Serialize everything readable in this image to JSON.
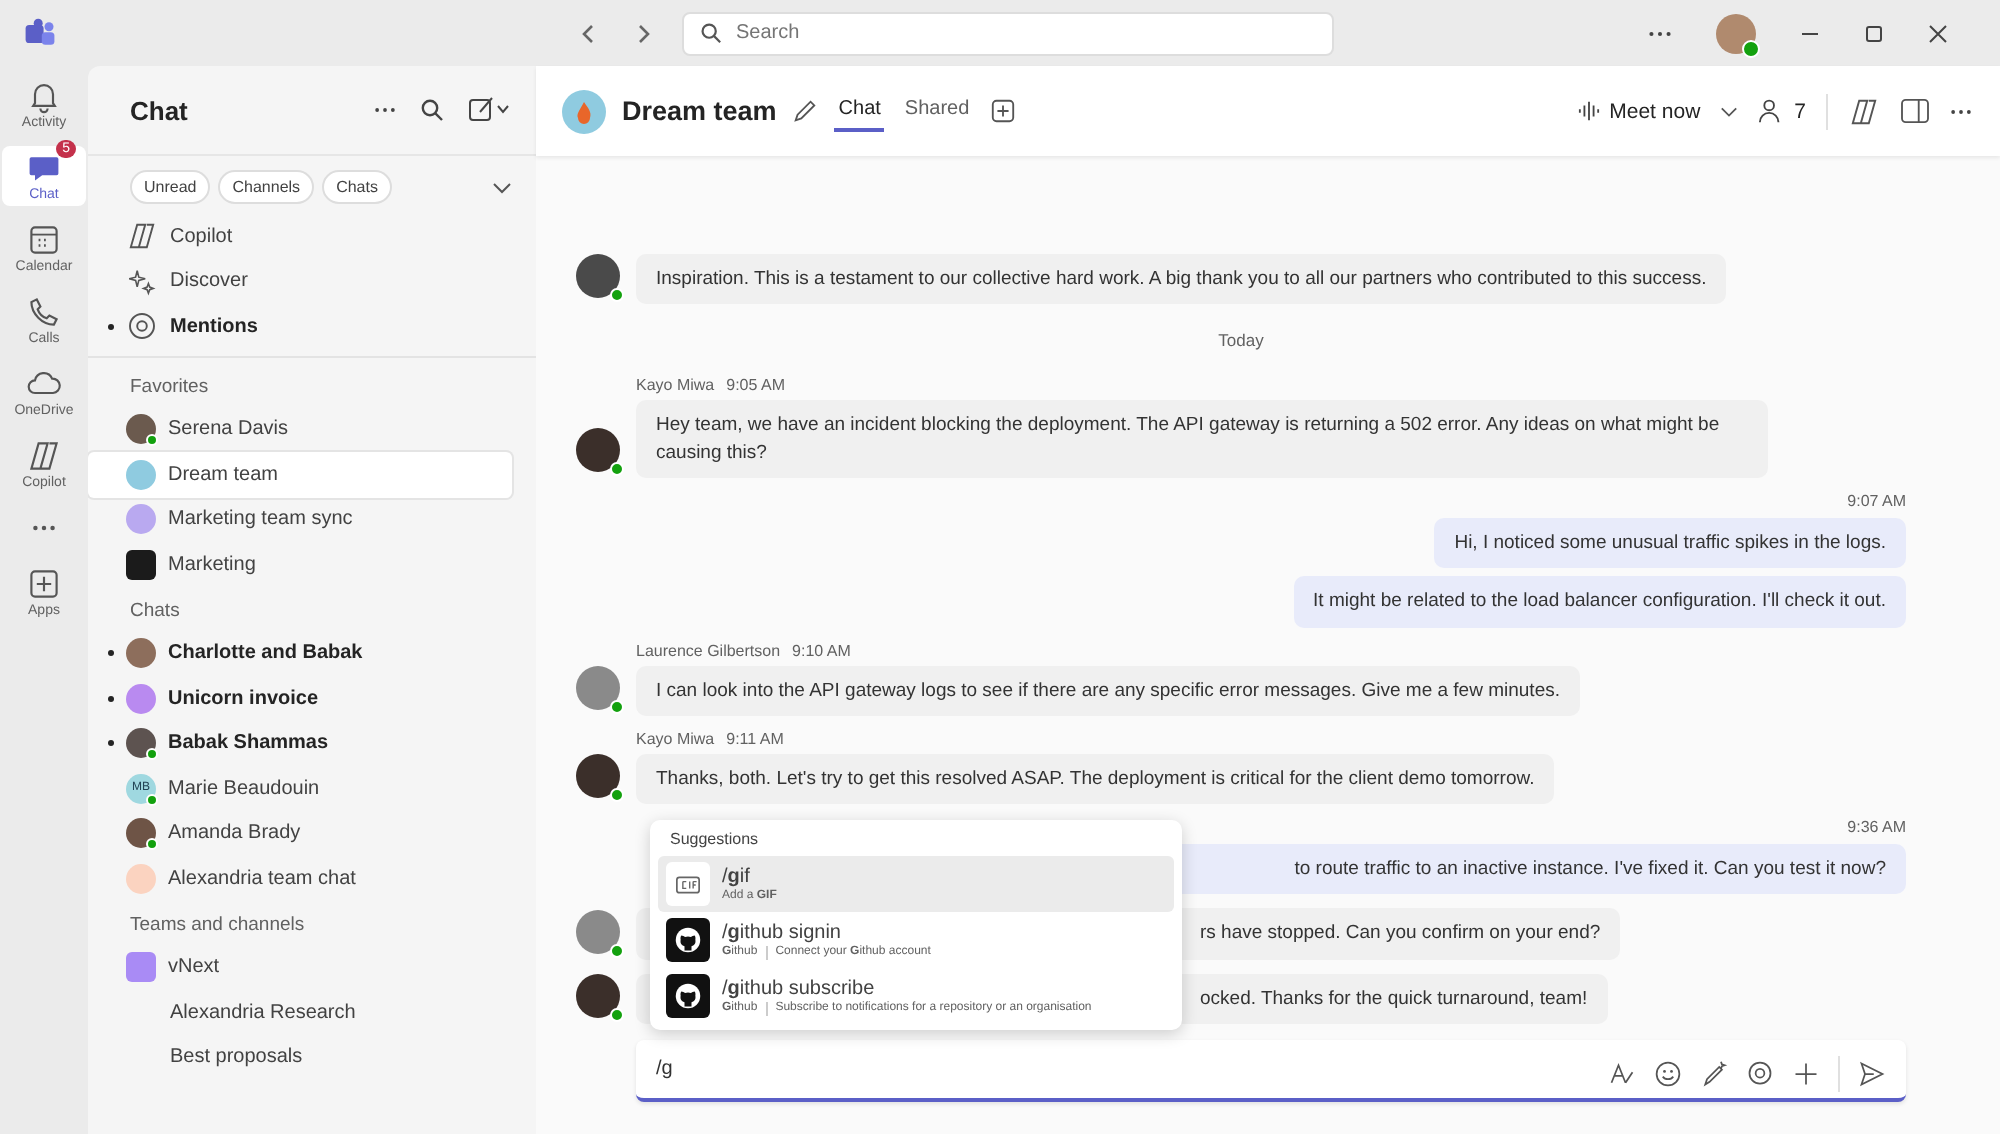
{
  "titlebar": {
    "search": {
      "placeholder": "Search"
    }
  },
  "rail": [
    {
      "kind": "bell",
      "label": "Activity",
      "selected": false
    },
    {
      "kind": "chat",
      "label": "Chat",
      "selected": true,
      "badge": "5"
    },
    {
      "kind": "calendar",
      "label": "Calendar",
      "selected": false
    },
    {
      "kind": "phone",
      "label": "Calls",
      "selected": false
    },
    {
      "kind": "cloud",
      "label": "OneDrive",
      "selected": false
    },
    {
      "kind": "copilot",
      "label": "Copilot",
      "selected": false
    },
    {
      "kind": "more",
      "selected": false
    },
    {
      "kind": "apps",
      "label": "Apps",
      "selected": false
    }
  ],
  "chat_list": {
    "title": "Chat",
    "filters": [
      "Unread",
      "Channels",
      "Chats"
    ],
    "top_items": [
      {
        "kind": "copilot",
        "label": "Copilot",
        "unread": false
      },
      {
        "kind": "discover",
        "label": "Discover",
        "unread": false
      },
      {
        "kind": "mention",
        "label": "Mentions",
        "unread": true
      }
    ],
    "sections": [
      {
        "title": "Favorites",
        "items": [
          {
            "name": "Serena Davis",
            "kind": "photo",
            "color": "#6b5a4e",
            "presence": true,
            "unread": false,
            "selected": false
          },
          {
            "name": "Dream team",
            "kind": "team",
            "color": "#8fcbe0",
            "presence": false,
            "unread": false,
            "selected": true
          },
          {
            "name": "Marketing team sync",
            "kind": "team",
            "color": "#b9a9f0",
            "presence": false,
            "unread": false,
            "selected": false
          },
          {
            "name": "Marketing",
            "kind": "square",
            "color": "#1b1b1b",
            "presence": false,
            "unread": false,
            "selected": false
          }
        ]
      },
      {
        "title": "Chats",
        "items": [
          {
            "name": "Charlotte and Babak",
            "kind": "photo",
            "color": "#8d6e5c",
            "presence": false,
            "unread": true,
            "selected": false
          },
          {
            "name": "Unicorn invoice",
            "kind": "team",
            "color": "#b98af0",
            "presence": false,
            "unread": true,
            "selected": false
          },
          {
            "name": "Babak Shammas",
            "kind": "photo",
            "color": "#5d5350",
            "presence": true,
            "unread": true,
            "selected": false
          },
          {
            "name": "Marie Beaudouin",
            "kind": "initials",
            "initials": "MB",
            "color": "#9fd8e0",
            "presence": true,
            "unread": false,
            "selected": false
          },
          {
            "name": "Amanda Brady",
            "kind": "photo",
            "color": "#6e5446",
            "presence": true,
            "unread": false,
            "selected": false
          },
          {
            "name": "Alexandria team chat",
            "kind": "team",
            "color": "#fbd3c0",
            "presence": false,
            "unread": false,
            "selected": false
          }
        ]
      },
      {
        "title": "Teams and channels",
        "items": [
          {
            "name": "vNext",
            "kind": "square",
            "color": "#a98bf5",
            "presence": false,
            "unread": false,
            "selected": false,
            "children": [
              {
                "name": "Alexandria Research"
              },
              {
                "name": "Best proposals"
              }
            ]
          }
        ]
      }
    ]
  },
  "header": {
    "title": "Dream team",
    "tabs": [
      {
        "label": "Chat",
        "selected": true
      },
      {
        "label": "Shared",
        "selected": false
      }
    ],
    "meet": "Meet now",
    "participants": "7"
  },
  "messages": [
    {
      "kind": "incoming",
      "color": "#4a4a4a",
      "bubbles": [
        "Inspiration. This is a testament to our collective hard work. A big thank you to all our partners who contributed to this success."
      ]
    },
    {
      "kind": "date",
      "text": "Today"
    },
    {
      "kind": "incoming",
      "sender": "Kayo Miwa",
      "time": "9:05 AM",
      "color": "#3b2f2a",
      "bubbles": [
        "Hey team, we have an incident blocking the deployment. The API gateway is returning a 502 error. Any ideas on what might be causing this?"
      ]
    },
    {
      "kind": "outgoing",
      "time": "9:07 AM",
      "bubbles": [
        "Hi, I noticed some unusual traffic spikes in the logs.",
        "It might be related to the load balancer configuration. I'll check it out."
      ]
    },
    {
      "kind": "incoming",
      "sender": "Laurence Gilbertson",
      "time": "9:10 AM",
      "color": "#8a8a8a",
      "bubbles": [
        "I can look into the API gateway logs to see if there are any specific error messages. Give me a few minutes."
      ]
    },
    {
      "kind": "incoming",
      "sender": "Kayo Miwa",
      "time": "9:11 AM",
      "color": "#3b2f2a",
      "bubbles": [
        "Thanks, both. Let's try to get this resolved ASAP. The deployment is critical for the client demo tomorrow."
      ]
    },
    {
      "kind": "covered_outgoing",
      "time": "9:36 AM",
      "bubbles": [
        "to route traffic to an inactive instance. I've fixed it. Can you test it now?"
      ]
    },
    {
      "kind": "covered",
      "color": "#8a8a8a",
      "bubbles": [
        "rs have stopped. Can you confirm on your end?"
      ]
    },
    {
      "kind": "covered",
      "color": "#3b2f2a",
      "bubbles": [
        "ocked. Thanks for the quick turnaround, team!"
      ]
    }
  ],
  "suggestions": {
    "title": "Suggestions",
    "items": [
      {
        "kind": "gif",
        "command": "/**g**if",
        "subtitle": "Add a **GIF**",
        "selected": true
      },
      {
        "kind": "github",
        "command": "/**g**ithub signin",
        "source": "**G**ithub",
        "subtitle": "Connect your **G**ithub account",
        "selected": false
      },
      {
        "kind": "github",
        "command": "/**g**ithub subscribe",
        "source": "**G**ithub",
        "subtitle": "Subscribe to notifications for a repository or an organisation",
        "selected": false
      }
    ]
  },
  "composer": {
    "value": "/g"
  }
}
